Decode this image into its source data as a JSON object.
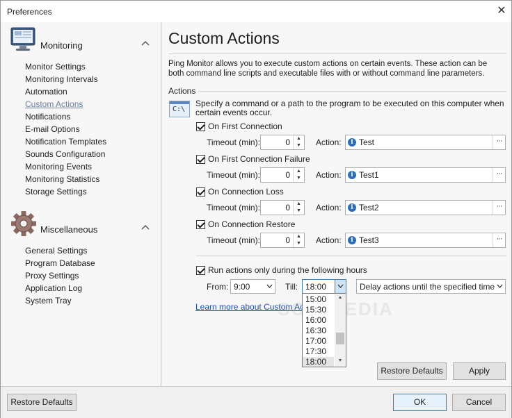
{
  "window": {
    "title": "Preferences",
    "close_glyph": "✕"
  },
  "sidebar": {
    "groups": [
      {
        "title": "Monitoring",
        "icon": "monitor-icon",
        "items": [
          "Monitor Settings",
          "Monitoring Intervals",
          "Automation",
          "Custom Actions",
          "Notifications",
          "E-mail Options",
          "Notification Templates",
          "Sounds Configuration",
          "Monitoring Events",
          "Monitoring Statistics",
          "Storage Settings"
        ],
        "active_item": "Custom Actions"
      },
      {
        "title": "Miscellaneous",
        "icon": "gear-icon",
        "items": [
          "General Settings",
          "Program Database",
          "Proxy Settings",
          "Application Log",
          "System Tray"
        ]
      }
    ]
  },
  "main": {
    "title": "Custom Actions",
    "description": "Ping Monitor allows you to execute custom actions on certain events. These action can be both command line scripts and executable files with or without command line parameters.",
    "section_label": "Actions",
    "section_icon_text": "C:\\",
    "section_help": "Specify a command or a path to the program to be executed on this computer when certain events occur.",
    "timeout_label": "Timeout (min):",
    "action_label": "Action:",
    "events": [
      {
        "label": "On First Connection",
        "checked": true,
        "timeout": "0",
        "action": "Test"
      },
      {
        "label": "On First Connection Failure",
        "checked": true,
        "timeout": "0",
        "action": "Test1"
      },
      {
        "label": "On Connection Loss",
        "checked": true,
        "timeout": "0",
        "action": "Test2"
      },
      {
        "label": "On Connection Restore",
        "checked": true,
        "timeout": "0",
        "action": "Test3"
      }
    ],
    "hours": {
      "checkbox_label": "Run actions only during the following hours",
      "checked": true,
      "from_label": "From:",
      "from_value": "9:00",
      "till_label": "Till:",
      "till_value": "18:00",
      "delay_value": "Delay actions until the specified time",
      "till_options": [
        "15:00",
        "15:30",
        "16:00",
        "16:30",
        "17:00",
        "17:30",
        "18:00"
      ],
      "till_selected": "18:00"
    },
    "learn_more": "Learn more about Custom Acti",
    "restore_defaults": "Restore Defaults",
    "apply": "Apply"
  },
  "footer": {
    "restore_defaults": "Restore Defaults",
    "ok": "OK",
    "cancel": "Cancel"
  },
  "watermark": "SOFTPEDIA",
  "colors": {
    "accent": "#3c7fb1",
    "link": "#1a4fa0",
    "active_nav": "#6b7fa3"
  }
}
